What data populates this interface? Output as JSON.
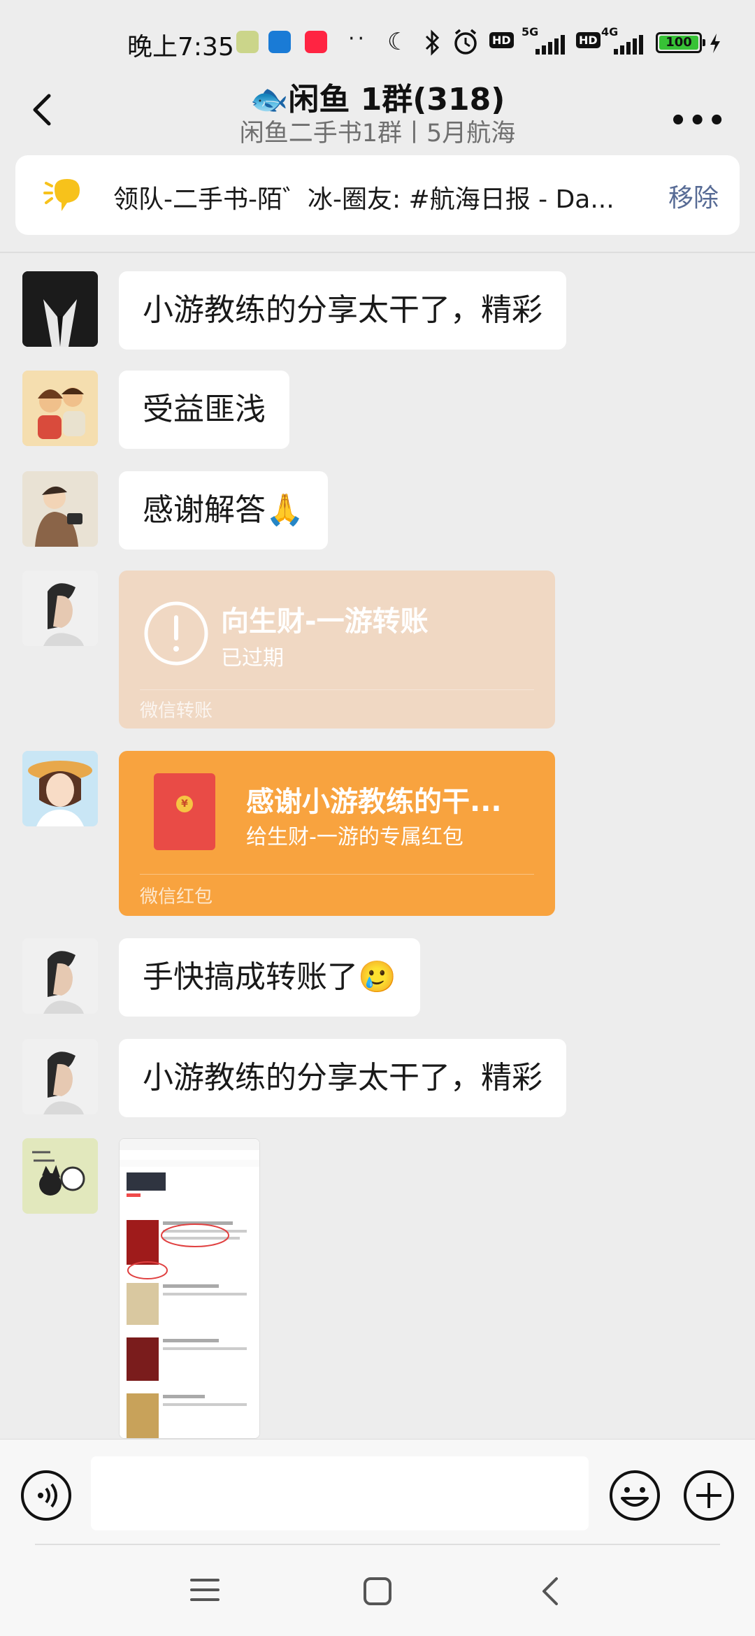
{
  "status_bar": {
    "time": "晚上7:35",
    "network_1": "5G",
    "network_2": "4G",
    "hd": "HD",
    "battery": "100"
  },
  "header": {
    "title": "🐟闲鱼 1群(318)",
    "subtitle": "闲鱼二手书1群丨5月航海"
  },
  "pinned_notice": {
    "text": "领队-二手书-陌゛冰-圈友: #航海日报 - Da...",
    "remove_label": "移除"
  },
  "messages": [
    {
      "type": "text",
      "text": "小游教练的分享太干了，精彩"
    },
    {
      "type": "text",
      "text": "受益匪浅"
    },
    {
      "type": "text",
      "text": "感谢解答🙏"
    },
    {
      "type": "transfer",
      "title": "向生财-一游转账",
      "status": "已过期",
      "footer": "微信转账"
    },
    {
      "type": "red_packet",
      "title": "感谢小游教练的干...",
      "subtitle": "给生财-一游的专属红包",
      "footer": "微信红包"
    },
    {
      "type": "text",
      "text": "手快搞成转账了🥲"
    },
    {
      "type": "text",
      "text": "小游教练的分享太干了，精彩"
    },
    {
      "type": "image"
    }
  ],
  "colors": {
    "background": "#ededed",
    "transfer_card": "#f0d8c3",
    "red_packet_card": "#f8a33f",
    "link": "#576b95"
  },
  "icons": {
    "back": "chevron-left-icon",
    "more": "more-dots-icon",
    "notice": "speech-bulb-icon",
    "voice": "voice-icon",
    "emoji": "emoji-icon",
    "plus": "plus-icon"
  }
}
